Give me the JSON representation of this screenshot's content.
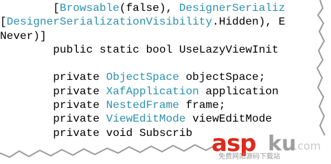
{
  "code_lines": [
    [
      {
        "t": "        [",
        "c": "plain"
      },
      {
        "t": "Browsable",
        "c": "type"
      },
      {
        "t": "(",
        "c": "plain"
      },
      {
        "t": "false",
        "c": "kw"
      },
      {
        "t": "), ",
        "c": "plain"
      },
      {
        "t": "DesignerSerializ",
        "c": "type"
      }
    ],
    [
      {
        "t": "[",
        "c": "plain"
      },
      {
        "t": "DesignerSerializationVisibility",
        "c": "type"
      },
      {
        "t": ".Hidden), E",
        "c": "plain"
      }
    ],
    [
      {
        "t": "Never)]",
        "c": "plain"
      }
    ],
    [
      {
        "t": "        ",
        "c": "plain"
      },
      {
        "t": "public",
        "c": "kw"
      },
      {
        "t": " ",
        "c": "plain"
      },
      {
        "t": "static",
        "c": "kw"
      },
      {
        "t": " ",
        "c": "plain"
      },
      {
        "t": "bool",
        "c": "kw"
      },
      {
        "t": " UseLazyViewInit",
        "c": "plain"
      }
    ],
    [
      {
        "t": "",
        "c": "plain"
      }
    ],
    [
      {
        "t": "        ",
        "c": "plain"
      },
      {
        "t": "private",
        "c": "kw"
      },
      {
        "t": " ",
        "c": "plain"
      },
      {
        "t": "ObjectSpace",
        "c": "type"
      },
      {
        "t": " objectSpace;",
        "c": "plain"
      }
    ],
    [
      {
        "t": "        ",
        "c": "plain"
      },
      {
        "t": "private",
        "c": "kw"
      },
      {
        "t": " ",
        "c": "plain"
      },
      {
        "t": "XafApplication",
        "c": "type"
      },
      {
        "t": " application",
        "c": "plain"
      }
    ],
    [
      {
        "t": "        ",
        "c": "plain"
      },
      {
        "t": "private",
        "c": "kw"
      },
      {
        "t": " ",
        "c": "plain"
      },
      {
        "t": "NestedFrame",
        "c": "type"
      },
      {
        "t": " frame;",
        "c": "plain"
      }
    ],
    [
      {
        "t": "        ",
        "c": "plain"
      },
      {
        "t": "private",
        "c": "kw"
      },
      {
        "t": " ",
        "c": "plain"
      },
      {
        "t": "ViewEditMode",
        "c": "type"
      },
      {
        "t": " viewEditMode",
        "c": "plain"
      }
    ],
    [
      {
        "t": "        ",
        "c": "plain"
      },
      {
        "t": "private",
        "c": "kw"
      },
      {
        "t": " ",
        "c": "plain"
      },
      {
        "t": "void",
        "c": "kw"
      },
      {
        "t": " Subscrib",
        "c": "plain"
      }
    ]
  ],
  "colors": {
    "type": "#2b91af",
    "keyword": "#000000",
    "text": "#000000",
    "background": "#ffffff",
    "watermark_red": "#e0281c",
    "watermark_gray": "#9e9e9e"
  },
  "watermark": {
    "brand": "asp",
    "ku": "ku",
    "domain": ".com",
    "tagline": "免费网站源码下载站"
  }
}
